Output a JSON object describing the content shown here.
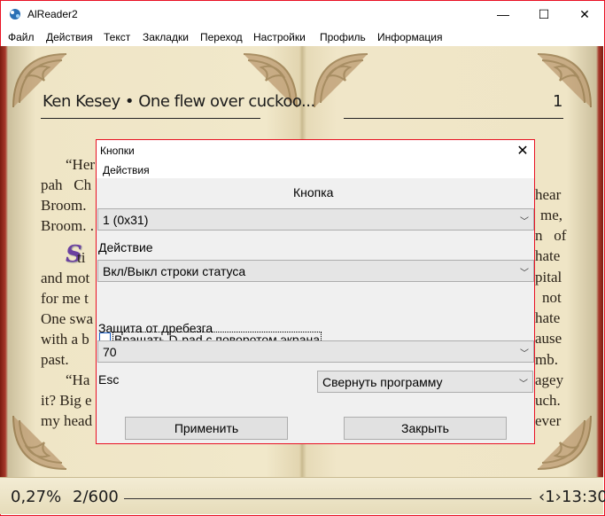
{
  "window": {
    "title": "AlReader2",
    "min_glyph": "—",
    "max_glyph": "☐",
    "close_glyph": "✕",
    "app_icon": "alreader-app-icon"
  },
  "menu": [
    "Файл",
    "Действия",
    "Текст",
    "Закладки",
    "Переход",
    "Настройки",
    "Профиль",
    "Информация"
  ],
  "book": {
    "header_left": "Ken Kesey • One flew over cuckoo...",
    "header_right": "1",
    "dropcap": "S",
    "lines": [
      {
        "t": "“Her"
      },
      {
        "t": "pah   Ch"
      },
      {
        "t": "Broom."
      },
      {
        "t": "Broom. ."
      },
      {
        "t": "    ti"
      },
      {
        "t": "and mot"
      },
      {
        "t": "for me t"
      },
      {
        "t": "One swa"
      },
      {
        "t": "with a b"
      },
      {
        "t": "past."
      },
      {
        "t": "“Ha"
      },
      {
        "t": "it? Big e"
      },
      {
        "t": "my head"
      }
    ],
    "right_lines": [
      "hear",
      "me,",
      "n   of",
      "hate",
      "pital",
      "not",
      "hate",
      "ause",
      "mb.",
      "agey",
      "uch.",
      "ever"
    ]
  },
  "status": {
    "percent": "0,27%",
    "pages": "2/600",
    "chapter": "‹1›",
    "time": "13:30"
  },
  "dialog": {
    "title": "Кнопки",
    "close_glyph": "✕",
    "menu": "Действия",
    "button_section": "Кнопка",
    "button_value": "1 (0x31)",
    "action_label": "Действие",
    "action_value": "Вкл/Выкл строки статуса",
    "rotate_label": "Вращать D-pad с поворотом экрана",
    "rotate_checked": false,
    "debounce_label": "Защита от дребезга",
    "debounce_value": "70",
    "esc_label": "Esc",
    "esc_value": "Свернуть программу",
    "apply_label": "Применить",
    "close_label": "Закрыть",
    "arrow_glyph": "﹀"
  }
}
